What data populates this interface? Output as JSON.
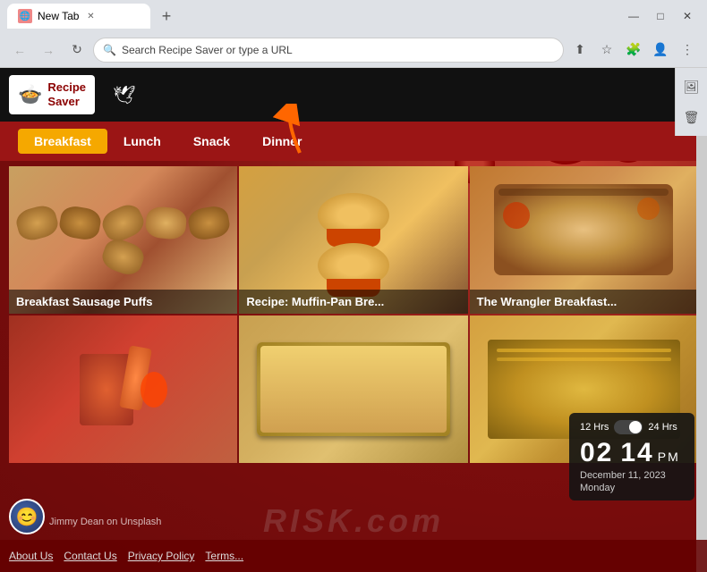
{
  "browser": {
    "tab_title": "New Tab",
    "tab_favicon": "🌐",
    "address_placeholder": "Search Recipe Saver or type a URL",
    "new_tab_label": "+",
    "window_minimize": "—",
    "window_maximize": "□",
    "window_close": "✕"
  },
  "header": {
    "logo_line1": "Recipe",
    "logo_line2": "Saver",
    "logo_icon": "🍲",
    "search_label": "🔍"
  },
  "categories": [
    {
      "label": "Breakfast",
      "active": true
    },
    {
      "label": "Lunch",
      "active": false
    },
    {
      "label": "Snack",
      "active": false
    },
    {
      "label": "Dinner",
      "active": false
    }
  ],
  "recipes": [
    {
      "title": "Breakfast Sausage Puffs",
      "color_class": "food-img-1"
    },
    {
      "title": "Recipe: Muffin-Pan Bre...",
      "color_class": "food-img-2"
    },
    {
      "title": "The Wrangler Breakfast...",
      "color_class": "food-img-3"
    },
    {
      "title": "",
      "color_class": "food-img-4"
    },
    {
      "title": "",
      "color_class": "food-img-5"
    },
    {
      "title": "",
      "color_class": "food-img-6"
    }
  ],
  "clock": {
    "toggle_12hr": "12 Hrs",
    "toggle_24hr": "24 Hrs",
    "hour": "02",
    "minute": "14",
    "ampm": "PM",
    "date": "December 11, 2023",
    "day": "Monday"
  },
  "footer": {
    "links": [
      "About Us",
      "Contact Us",
      "Privacy Policy",
      "Terms..."
    ]
  },
  "photo_credit": "Jimmy Dean on Unsplash",
  "watermark": {
    "main": "RISK.com",
    "sub": ""
  }
}
